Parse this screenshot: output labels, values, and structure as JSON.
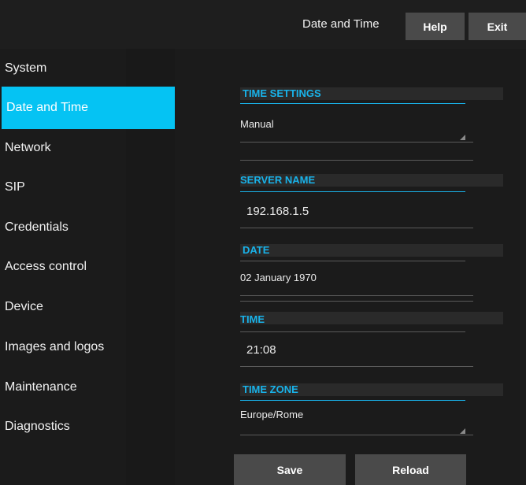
{
  "header": {
    "title": "Date and Time",
    "help_label": "Help",
    "exit_label": "Exit"
  },
  "sidebar": {
    "items": [
      {
        "label": "System"
      },
      {
        "label": "Date and Time"
      },
      {
        "label": "Network"
      },
      {
        "label": "SIP"
      },
      {
        "label": "Credentials"
      },
      {
        "label": "Access control"
      },
      {
        "label": "Device"
      },
      {
        "label": "Images and logos"
      },
      {
        "label": "Maintenance"
      },
      {
        "label": "Diagnostics"
      }
    ],
    "active_index": 1
  },
  "form": {
    "time_settings": {
      "title": "TIME SETTINGS",
      "value": "Manual"
    },
    "server_name": {
      "title": "SERVER NAME",
      "value": "192.168.1.5"
    },
    "date": {
      "title": "DATE",
      "value": "02 January 1970"
    },
    "time": {
      "title": "TIME",
      "value": "21:08"
    },
    "time_zone": {
      "title": "TIME ZONE",
      "value": "Europe/Rome"
    }
  },
  "footer": {
    "save_label": "Save",
    "reload_label": "Reload"
  },
  "colors": {
    "accent": "#05c3f3",
    "section_title": "#19b3ea",
    "button": "#4a4a4a",
    "background": "#1b1b1b"
  }
}
